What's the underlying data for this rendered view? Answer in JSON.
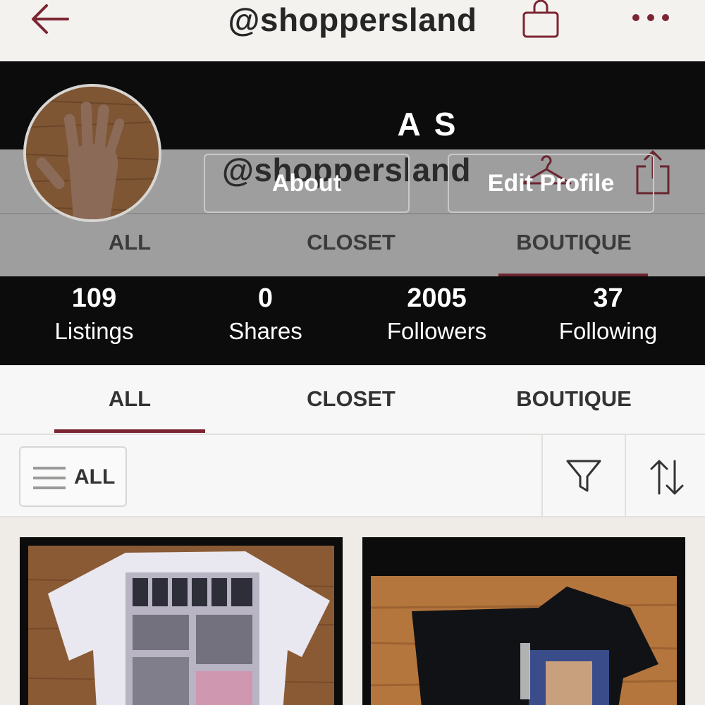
{
  "topbar": {
    "title": "@shoppersland",
    "back_icon": "arrow-left-icon",
    "bag_icon": "shopping-bag-icon",
    "more_icon": "more-dots-icon"
  },
  "profile": {
    "name": "A S",
    "handle": "@shoppersland",
    "about_label": "About",
    "edit_label": "Edit Profile"
  },
  "stats": [
    {
      "value": "109",
      "label": "Listings"
    },
    {
      "value": "0",
      "label": "Shares"
    },
    {
      "value": "2005",
      "label": "Followers"
    },
    {
      "value": "37",
      "label": "Following"
    }
  ],
  "tabs": [
    {
      "label": "ALL",
      "active": true
    },
    {
      "label": "CLOSET",
      "active": false
    },
    {
      "label": "BOUTIQUE",
      "active": false
    }
  ],
  "ghost_tabs": [
    {
      "label": "ALL"
    },
    {
      "label": "CLOSET"
    },
    {
      "label": "BOUTIQUE"
    }
  ],
  "filter": {
    "all_label": "ALL",
    "filter_icon": "funnel-icon",
    "sort_icon": "sort-arrows-icon"
  },
  "colors": {
    "accent": "#7b2532",
    "header_bg": "#0c0c0c",
    "page_bg": "#f4f2ef"
  }
}
